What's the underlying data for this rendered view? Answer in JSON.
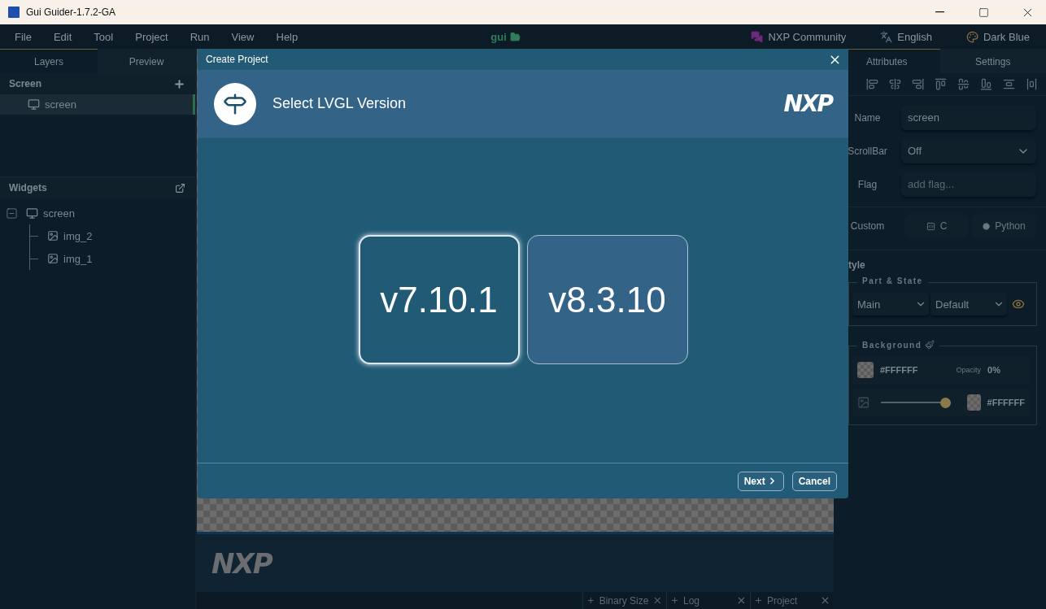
{
  "window": {
    "title": "Gui Guider-1.7.2-GA"
  },
  "menu": [
    "File",
    "Edit",
    "Tool",
    "Project",
    "Run",
    "View",
    "Help"
  ],
  "project": {
    "name": "gui"
  },
  "toolbar_links": [
    {
      "kind": "community",
      "label": "NXP Community"
    },
    {
      "kind": "language",
      "label": "English"
    },
    {
      "kind": "theme",
      "label": "Dark Blue"
    }
  ],
  "left_panel": {
    "tabs": [
      {
        "label": "Layers",
        "selected": true
      },
      {
        "label": "Preview",
        "selected": false
      }
    ],
    "screens": {
      "title": "Screen",
      "items": [
        {
          "label": "screen",
          "selected": true
        }
      ]
    },
    "widgets": {
      "title": "Widgets",
      "tree": [
        {
          "label": "screen",
          "expanded": true,
          "children": [
            {
              "label": "img_2"
            },
            {
              "label": "img_1"
            }
          ]
        }
      ]
    }
  },
  "canvas": {
    "logo": "NXP"
  },
  "dock_tabs": [
    "Binary Size",
    "Log",
    "Project"
  ],
  "right_panel": {
    "tabs": [
      {
        "label": "Attributes",
        "selected": true
      },
      {
        "label": "Settings",
        "selected": false
      }
    ],
    "name": {
      "label": "Name",
      "value": "screen"
    },
    "scrollbar": {
      "label": "ScrollBar",
      "value": "Off"
    },
    "flag": {
      "label": "Flag",
      "placeholder": "add flag..."
    },
    "custom": {
      "label": "Custom",
      "buttons": [
        {
          "kind": "c",
          "label": "C"
        },
        {
          "kind": "python",
          "label": "Python"
        }
      ]
    },
    "style": {
      "title": "tyle",
      "part_state": {
        "title": "Part & State",
        "part": "Main",
        "state": "Default"
      },
      "background": {
        "title": "Background",
        "hex": "#FFFFFF",
        "opacity_label": "Opacity",
        "opacity": "0%",
        "gradient": {
          "level": 1,
          "hex": "#FFFFFF"
        }
      }
    }
  },
  "dialog": {
    "title": "Create Project",
    "heading": "Select LVGL Version",
    "logo": "NXP",
    "versions": [
      {
        "label": "v7.10.1",
        "selected": true
      },
      {
        "label": "v8.3.10",
        "selected": false
      }
    ],
    "buttons": [
      {
        "kind": "next",
        "label": "Next"
      },
      {
        "kind": "cancel",
        "label": "Cancel"
      }
    ]
  }
}
